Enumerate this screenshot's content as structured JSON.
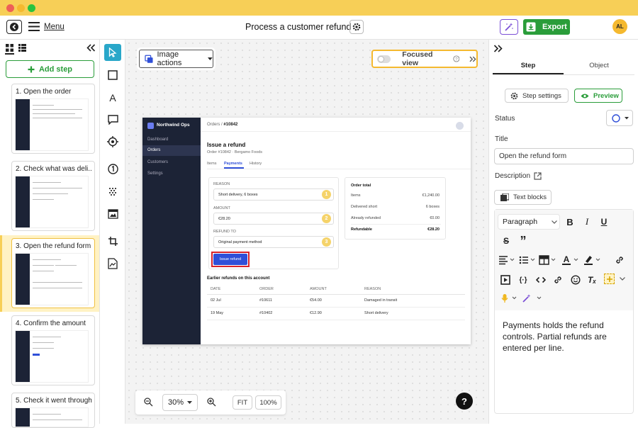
{
  "header": {
    "menu_label": "Menu",
    "title": "Process a customer refund",
    "export_label": "Export",
    "avatar_initials": "AL"
  },
  "left_panel": {
    "add_step_label": "Add step",
    "steps": [
      {
        "label": "1. Open the order"
      },
      {
        "label": "2. Check what was deli..."
      },
      {
        "label": "3. Open the refund form"
      },
      {
        "label": "4. Confirm the amount"
      },
      {
        "label": "5. Check it went through"
      }
    ],
    "selected_index": 2
  },
  "canvas": {
    "image_actions_label": "Image actions",
    "focused_view_label": "Focused view",
    "zoom_value": "30%",
    "fit_label": "FIT",
    "hundred_label": "100%",
    "help_label": "?"
  },
  "screenshot": {
    "brand": "Northwind Ops",
    "nav": [
      "Dashboard",
      "Orders",
      "Customers",
      "Settings"
    ],
    "breadcrumb_parent": "Orders /",
    "breadcrumb_current": "#10842",
    "heading": "Issue a refund",
    "subheading": "Order #10842 · Bergamo Foods",
    "tabs": [
      "Items",
      "Payments",
      "History"
    ],
    "form": {
      "reason_label": "REASON",
      "reason_value": "Short delivery, 6 boxes",
      "amount_label": "AMOUNT",
      "amount_value": "€28.20",
      "refund_to_label": "REFUND TO",
      "refund_to_value": "Original payment method",
      "badges": [
        "1",
        "2",
        "3"
      ],
      "button_label": "Issue refund"
    },
    "order_total": {
      "title": "Order total",
      "rows": [
        {
          "label": "Items",
          "value": "€1,240.00"
        },
        {
          "label": "Delivered short",
          "value": "6 boxes"
        },
        {
          "label": "Already refunded",
          "value": "€0.00"
        },
        {
          "label": "Refundable",
          "value": "€28.20"
        }
      ]
    },
    "earlier_title": "Earlier refunds on this account",
    "table_headers": [
      "DATE",
      "ORDER",
      "AMOUNT",
      "REASON"
    ],
    "table_rows": [
      [
        "02 Jul",
        "#10611",
        "€54.00",
        "Damaged in transit"
      ],
      [
        "19 May",
        "#10402",
        "€12.90",
        "Short delivery"
      ]
    ]
  },
  "right_panel": {
    "tabs": [
      "Step",
      "Object"
    ],
    "step_settings_label": "Step settings",
    "preview_label": "Preview",
    "status_label": "Status",
    "title_label": "Title",
    "title_value": "Open the refund form",
    "description_label": "Description",
    "text_blocks_label": "Text blocks",
    "paragraph_label": "Paragraph",
    "description_text": "Payments holds the refund controls. Partial refunds are entered per line."
  },
  "colors": {
    "accent_yellow": "#f7cf57",
    "export_green": "#2a9d3a",
    "selected_bg": "#fff2c4",
    "app_blue": "#2f4fd8",
    "highlight_red": "#d8232a",
    "sidebar_dark": "#1c2336"
  }
}
